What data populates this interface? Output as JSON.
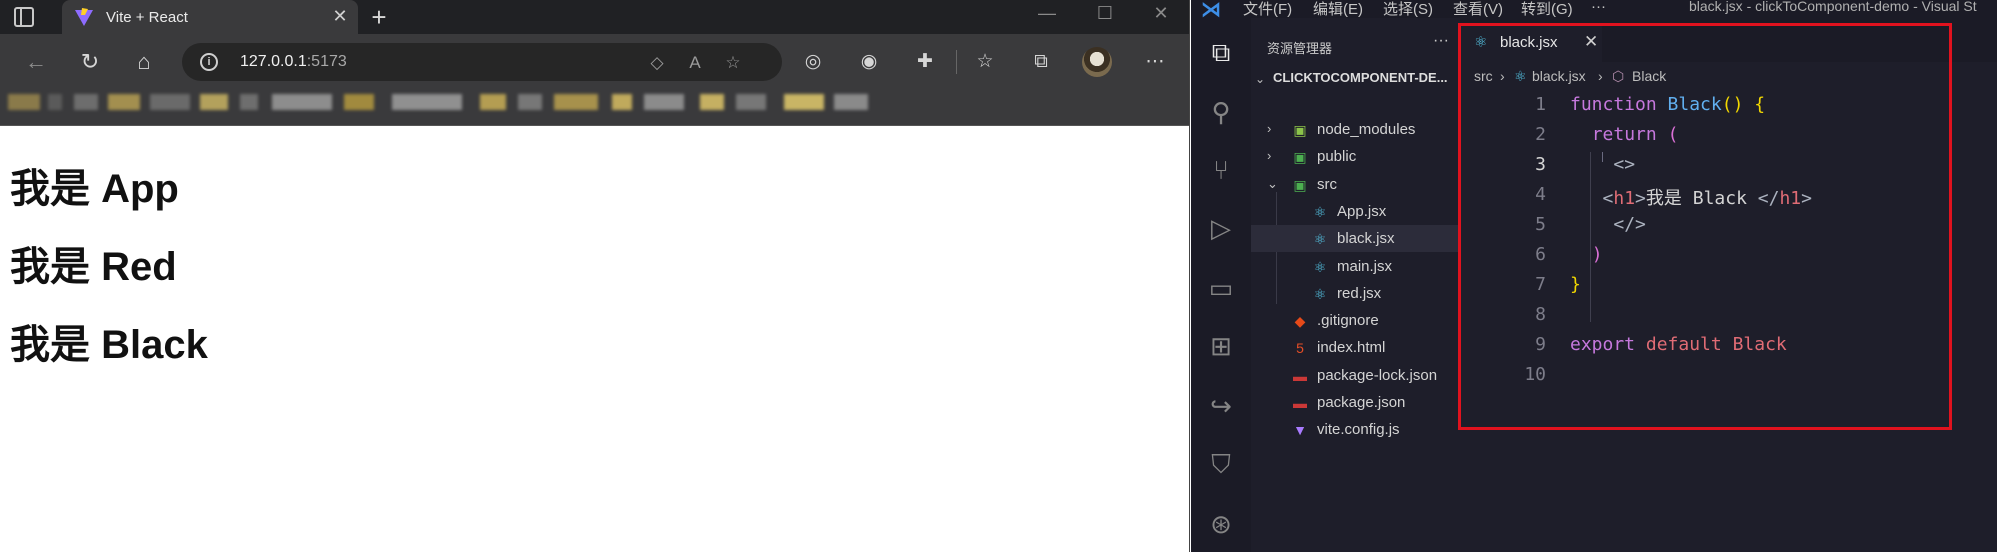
{
  "browser": {
    "tab_title": "Vite + React",
    "tab_close": "✕",
    "new_tab": "+",
    "window_controls": {
      "minimize": "—",
      "maximize": "☐",
      "close": "✕"
    },
    "url_host": "127.0.0.1",
    "url_port": ":5173",
    "page_headings": [
      "我是 App",
      "我是 Red",
      "我是 Black"
    ]
  },
  "vscode": {
    "menu": [
      "文件(F)",
      "编辑(E)",
      "选择(S)",
      "查看(V)",
      "转到(G)",
      "···"
    ],
    "window_title": "black.jsx - clickToComponent-demo - Visual St",
    "explorer_header": "资源管理器",
    "explorer_more": "···",
    "project_name": "CLICKTOCOMPONENT-DE...",
    "tree": [
      {
        "name": "node_modules",
        "kind": "folder",
        "icon": "node-folder-icon",
        "color": "#8bc34a"
      },
      {
        "name": "public",
        "kind": "folder",
        "icon": "public-folder-icon",
        "color": "#4caf50"
      },
      {
        "name": "src",
        "kind": "folder-open",
        "icon": "src-folder-icon",
        "color": "#4caf50"
      },
      {
        "name": "App.jsx",
        "kind": "file",
        "icon": "react-icon",
        "color": "#56c8e8"
      },
      {
        "name": "black.jsx",
        "kind": "file",
        "icon": "react-icon",
        "color": "#56c8e8",
        "selected": true
      },
      {
        "name": "main.jsx",
        "kind": "file",
        "icon": "react-icon",
        "color": "#56c8e8"
      },
      {
        "name": "red.jsx",
        "kind": "file",
        "icon": "react-icon",
        "color": "#56c8e8"
      },
      {
        "name": ".gitignore",
        "kind": "file",
        "icon": "git-icon",
        "color": "#e64a19"
      },
      {
        "name": "index.html",
        "kind": "file",
        "icon": "html5-icon",
        "color": "#e44d26"
      },
      {
        "name": "package-lock.json",
        "kind": "file",
        "icon": "npm-icon",
        "color": "#cb3837"
      },
      {
        "name": "package.json",
        "kind": "file",
        "icon": "npm-icon",
        "color": "#cb3837"
      },
      {
        "name": "vite.config.js",
        "kind": "file",
        "icon": "vite-icon",
        "color": "#a97bff"
      }
    ],
    "editor_tab": "black.jsx",
    "editor_tab_close": "✕",
    "breadcrumb": [
      "src",
      "black.jsx",
      "Black"
    ],
    "line_numbers": [
      "1",
      "2",
      "3",
      "4",
      "5",
      "6",
      "7",
      "8",
      "9",
      "10"
    ],
    "current_line": "3",
    "code": {
      "l1_kw": "function",
      "l1_fn": "Black",
      "l1_paren": "()",
      "l1_brace": "{",
      "l2_kw": "return",
      "l2_paren": "(",
      "l3": "<>",
      "l4_open_lt": "<",
      "l4_open_tag": "h1",
      "l4_open_gt": ">",
      "l4_text": "我是 Black ",
      "l4_close_lt": "</",
      "l4_close_tag": "h1",
      "l4_close_gt": ">",
      "l5": "</>",
      "l6": ")",
      "l7": "}",
      "l9_kw1": "export",
      "l9_kw2": "default",
      "l9_id": "Black"
    },
    "highlight_color": "#e1121e"
  }
}
